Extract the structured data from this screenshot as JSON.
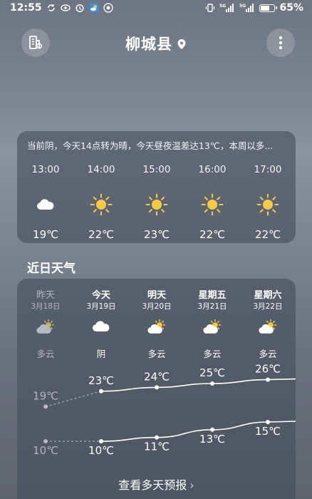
{
  "status_bar": {
    "time": "12:55",
    "battery": "65%",
    "battery_fraction": 0.65,
    "icons": [
      "sync-icon",
      "eye-icon",
      "alarm-icon",
      "weather-app-icon",
      "notification-icon",
      "vibrate-icon",
      "signal-5g-icon",
      "signal-5g-icon",
      "battery-icon"
    ]
  },
  "header": {
    "city": "柳城县",
    "left_icon": "city-manage-icon",
    "right_icon": "more-vertical-icon",
    "pin_icon": "location-pin-icon"
  },
  "hourly": {
    "summary": "当前阴，今天14点转为晴，今天昼夜温差达13℃，本周以多...",
    "hours": [
      {
        "time": "13:00",
        "icon": "cloudy",
        "temp": "19℃"
      },
      {
        "time": "14:00",
        "icon": "sunny",
        "temp": "22℃"
      },
      {
        "time": "15:00",
        "icon": "sunny",
        "temp": "23℃"
      },
      {
        "time": "16:00",
        "icon": "sunny",
        "temp": "22℃"
      },
      {
        "time": "17:00",
        "icon": "sunny",
        "temp": "22℃"
      }
    ]
  },
  "daily": {
    "title": "近日天气",
    "days": [
      {
        "name": "昨天",
        "date": "3月18日",
        "icon": "partly-cloudy",
        "cond": "多云",
        "high": "19℃",
        "low": "10℃",
        "high_val": 19,
        "low_val": 10,
        "past": true
      },
      {
        "name": "今天",
        "date": "3月19日",
        "icon": "cloudy",
        "cond": "阴",
        "high": "23℃",
        "low": "10℃",
        "high_val": 23,
        "low_val": 10,
        "past": false
      },
      {
        "name": "明天",
        "date": "3月20日",
        "icon": "partly-cloudy",
        "cond": "多云",
        "high": "24℃",
        "low": "11℃",
        "high_val": 24,
        "low_val": 11,
        "past": false
      },
      {
        "name": "星期五",
        "date": "3月21日",
        "icon": "partly-cloudy",
        "cond": "多云",
        "high": "25℃",
        "low": "13℃",
        "high_val": 25,
        "low_val": 13,
        "past": false
      },
      {
        "name": "星期六",
        "date": "3月22日",
        "icon": "partly-cloudy",
        "cond": "多云",
        "high": "26℃",
        "low": "15℃",
        "high_val": 26,
        "low_val": 15,
        "past": false
      }
    ],
    "more_label": "查看多天预报",
    "more_icon": "chevron-right-icon"
  },
  "colors": {
    "sun": "#f7c948",
    "cloud": "#ffffff",
    "cloud_gray": "#b5bbc3"
  }
}
